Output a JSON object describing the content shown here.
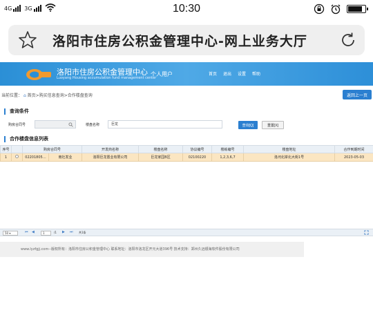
{
  "status_bar": {
    "network1": "4G",
    "network2": "3G",
    "time": "10:30",
    "battery_level": 0.75
  },
  "address_bar": {
    "title": "洛阳市住房公积金管理中心-网上业务大厅"
  },
  "site_header": {
    "site_name": "洛阳市住房公积金管理中心",
    "site_subtitle": "Luoyang Housing accumulation fund management center",
    "personal_user": "个人用户",
    "nav": [
      "首页",
      "退出",
      "设置",
      "帮助"
    ]
  },
  "breadcrumb": {
    "prefix": "当前位置：",
    "path": "首页>购买信息查询>合作楼盘查询",
    "back_button": "返回上一页"
  },
  "query_section": {
    "heading": "查询条件",
    "field1_label": "购房合同号",
    "field1_value": "",
    "field2_label": "楼盘名称",
    "field2_value": "巨龙",
    "query_button": "查询[Q]",
    "reset_button": "重置[X]"
  },
  "results_section": {
    "heading": "合作楼盘信息列表",
    "columns": [
      "序号",
      "",
      "购房合同号",
      "开发商名称",
      "楼盘名称",
      "协议编号",
      "楼栋编号",
      "楼盘地址",
      "合作到期时间"
    ],
    "rows": [
      {
        "index": "1",
        "contract": "02201805…",
        "seller": "南社发业",
        "developer": "洛阳巨龙置业有限公司",
        "project": "巨龙家园B区",
        "agreement": "02100220",
        "buildings": "1,2,3,6,7",
        "address": "洛河北岸北大街1号",
        "expiry": "2023-05-03"
      }
    ]
  },
  "pager": {
    "page_size": "50",
    "current_page": "1",
    "total_pages": "/1",
    "total_records": "共1条"
  },
  "footer": {
    "text": "www.lyzfgjj.com--版权所有：洛阳市住房公积金管理中心 联系地址：洛阳市洛龙区开元大道396号 技术支持：郑州久远银海软件股份有限公司"
  }
}
